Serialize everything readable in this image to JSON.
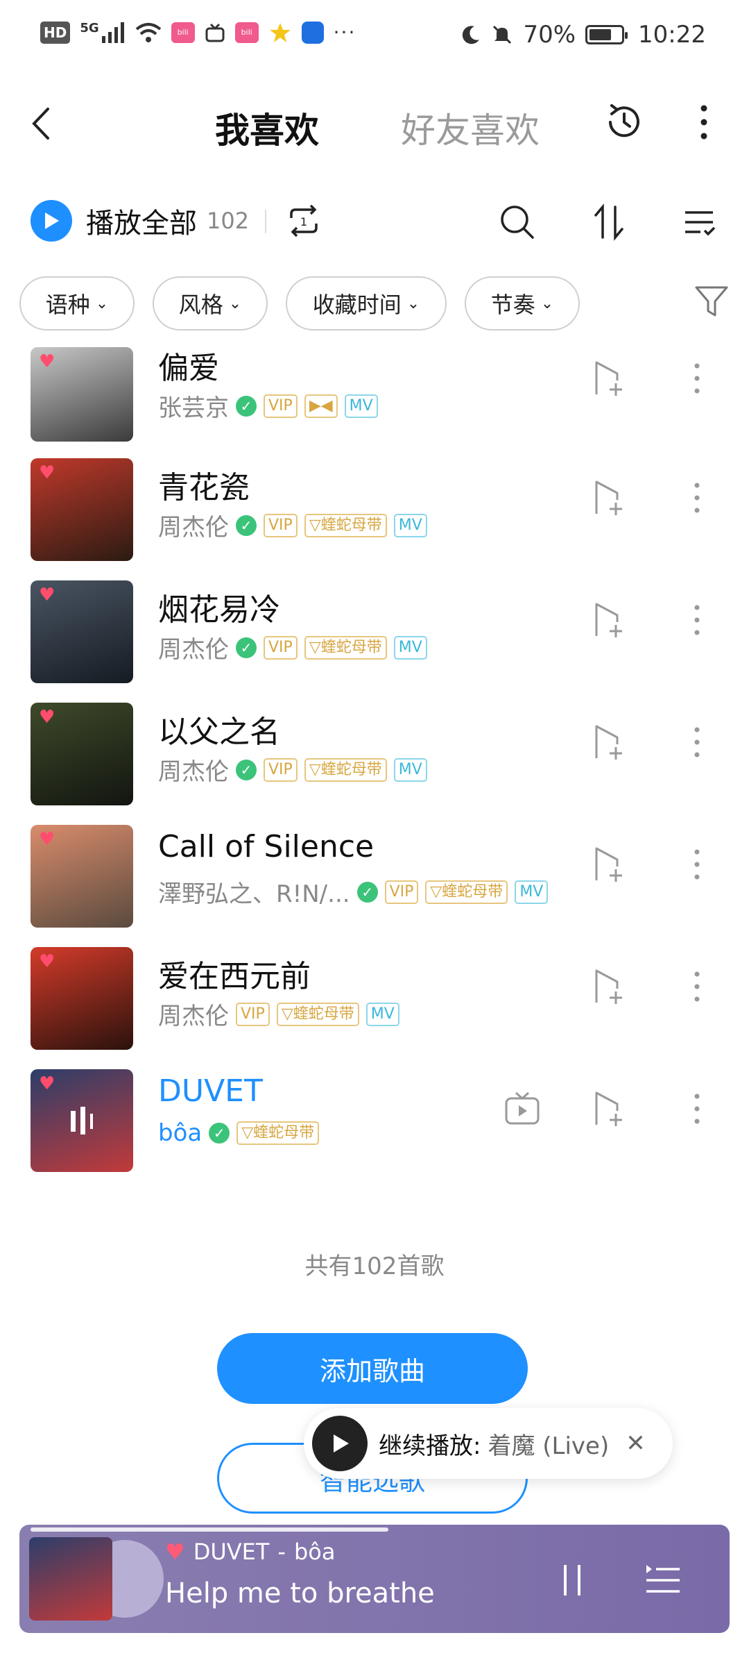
{
  "status_bar": {
    "hd": "HD",
    "network": "5G",
    "app_icons": [
      "bilibili",
      "bilibili"
    ],
    "dots": "···",
    "battery_text": "70%",
    "battery_level": 0.7,
    "time": "10:22"
  },
  "header": {
    "tab_mine": "我喜欢",
    "tab_friends": "好友喜欢"
  },
  "toolbar": {
    "play_all": "播放全部",
    "count": "102"
  },
  "filters": [
    "语种",
    "风格",
    "收藏时间",
    "节奏"
  ],
  "songs": [
    {
      "title": "偏爱",
      "artist": "张芸京",
      "verified": true,
      "badges": [
        "VIP",
        "dolby",
        "MV"
      ],
      "cover": [
        "#c8c8c8",
        "#3a3a3a"
      ]
    },
    {
      "title": "青花瓷",
      "artist": "周杰伦",
      "verified": true,
      "badges": [
        "VIP",
        "▽蝰蛇母带",
        "MV"
      ],
      "cover": [
        "#c0392b",
        "#2b1b12"
      ]
    },
    {
      "title": "烟花易冷",
      "artist": "周杰伦",
      "verified": true,
      "badges": [
        "VIP",
        "▽蝰蛇母带",
        "MV"
      ],
      "cover": [
        "#4a5563",
        "#151b22"
      ]
    },
    {
      "title": "以父之名",
      "artist": "周杰伦",
      "verified": true,
      "badges": [
        "VIP",
        "▽蝰蛇母带",
        "MV"
      ],
      "cover": [
        "#3f4a2a",
        "#121510"
      ]
    },
    {
      "title": "Call of Silence",
      "artist": "澤野弘之、R!N/...",
      "verified": true,
      "badges": [
        "VIP",
        "▽蝰蛇母带",
        "MV"
      ],
      "cover": [
        "#d98c6c",
        "#5a4a3e"
      ]
    },
    {
      "title": "爱在西元前",
      "artist": "周杰伦",
      "verified": false,
      "badges": [
        "VIP",
        "▽蝰蛇母带",
        "MV"
      ],
      "cover": [
        "#d43b2a",
        "#2a120c"
      ]
    },
    {
      "title": "DUVET",
      "artist": "bôa",
      "verified": true,
      "badges": [
        "▽蝰蛇母带"
      ],
      "cover": [
        "#2c3e6a",
        "#c23a3a"
      ],
      "playing": true
    }
  ],
  "total_text": "共有102首歌",
  "add_songs": "添加歌曲",
  "smart_pick": "智能选歌",
  "resume": {
    "label": "继续播放:",
    "song": "着魔 (Live)"
  },
  "player": {
    "title": "DUVET",
    "separator": "-",
    "artist": "bôa",
    "lyric": "Help me to breathe",
    "progress": 0.52
  },
  "colors": {
    "accent": "#1e8fff",
    "heart": "#ff4d6d",
    "vip_gold": "#d7a640",
    "mv_blue": "#3bb7d9",
    "verified_green": "#3cc37a",
    "player_bg": "#8a7eb0"
  }
}
